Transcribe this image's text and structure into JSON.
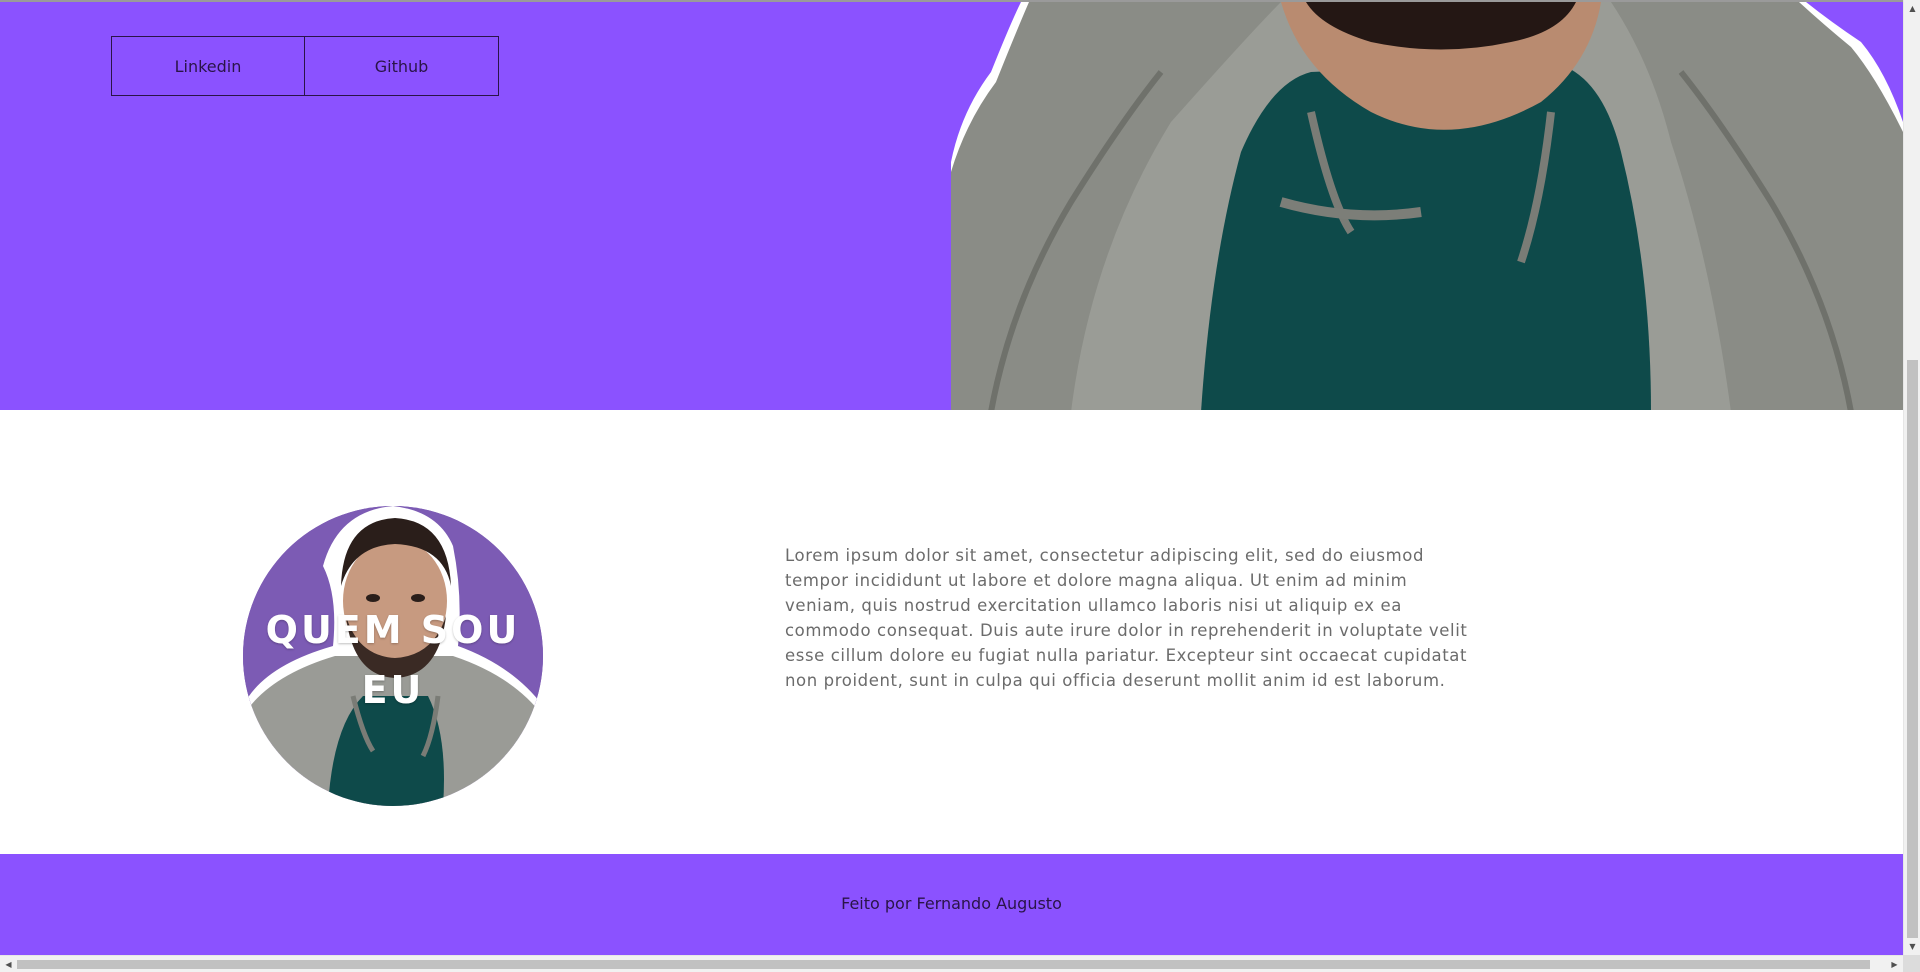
{
  "colors": {
    "accent": "#8b52ff",
    "footer_text": "#2a1448",
    "body_text": "#6b6b6b",
    "avatar_bg": "#7c5bb4"
  },
  "hero": {
    "social_links": [
      {
        "label": "Linkedin"
      },
      {
        "label": "Github"
      }
    ],
    "photo_icon": "person-photo"
  },
  "about": {
    "title": "QUEM SOU EU",
    "text": "Lorem ipsum dolor sit amet, consectetur adipiscing elit, sed do eiusmod tempor incididunt ut labore et dolore magna aliqua. Ut enim ad minim veniam, quis nostrud exercitation ullamco laboris nisi ut aliquip ex ea commodo consequat. Duis aute irure dolor in reprehenderit in voluptate velit esse cillum dolore eu fugiat nulla pariatur. Excepteur sint occaecat cupidatat non proident, sunt in culpa qui officia deserunt mollit anim id est laborum."
  },
  "footer": {
    "text": "Feito por Fernando Augusto"
  },
  "scrollbars": {
    "up_arrow": "▲",
    "down_arrow": "▼",
    "left_arrow": "◀",
    "right_arrow": "▶"
  }
}
